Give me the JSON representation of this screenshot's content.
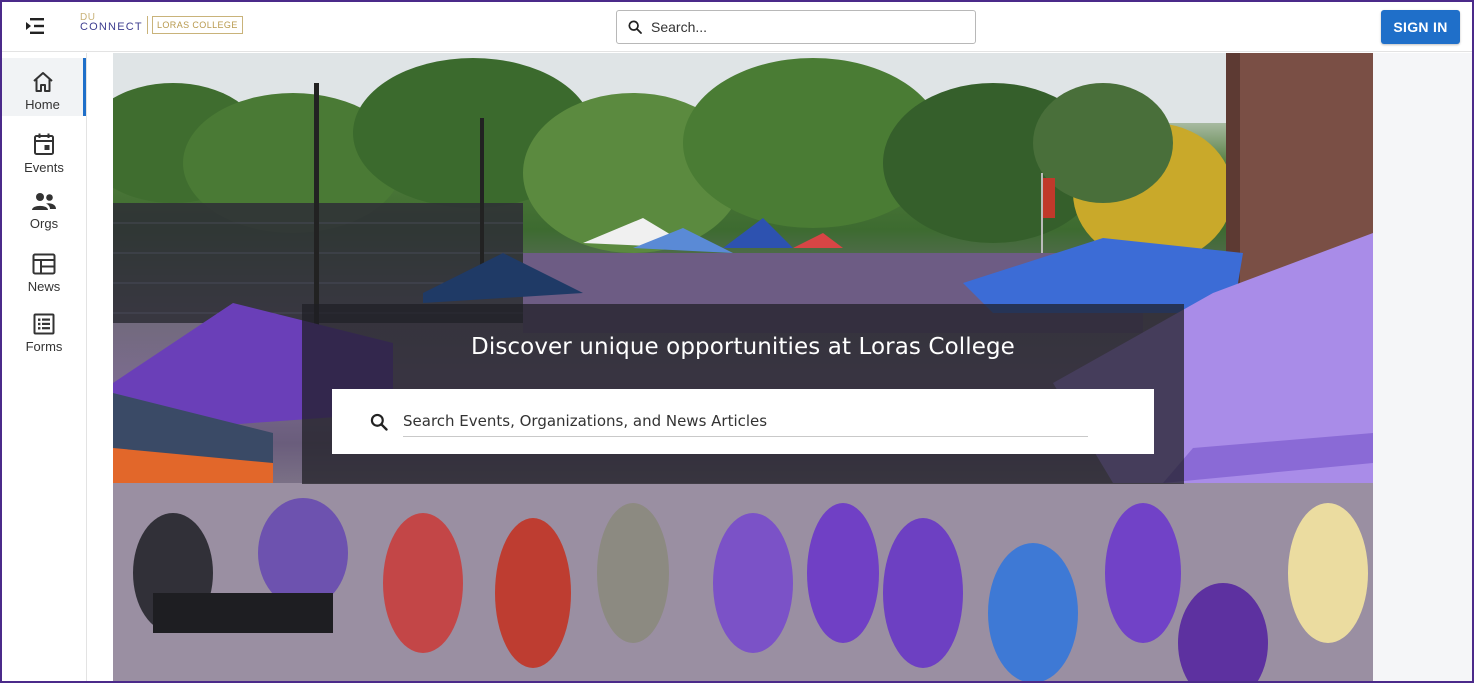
{
  "header": {
    "logo": {
      "du_text": "DU",
      "connect_text": "CONNECT",
      "college_text": "LORAS COLLEGE"
    },
    "search_placeholder": "Search...",
    "signin_label": "SIGN IN"
  },
  "sidebar": {
    "items": [
      {
        "label": "Home",
        "icon": "home-icon",
        "active": true
      },
      {
        "label": "Events",
        "icon": "calendar-icon",
        "active": false
      },
      {
        "label": "Orgs",
        "icon": "people-icon",
        "active": false
      },
      {
        "label": "News",
        "icon": "news-icon",
        "active": false
      },
      {
        "label": "Forms",
        "icon": "forms-icon",
        "active": false
      }
    ]
  },
  "hero": {
    "title": "Discover unique opportunities at Loras College",
    "search_placeholder": "Search Events, Organizations, and News Articles",
    "image_description_icon": "hero-photo"
  },
  "colors": {
    "accent": "#1f6fc9",
    "frame": "#4b2a8a",
    "brand_purple": "#5a2ca0",
    "brand_gold": "#c9b37a"
  }
}
